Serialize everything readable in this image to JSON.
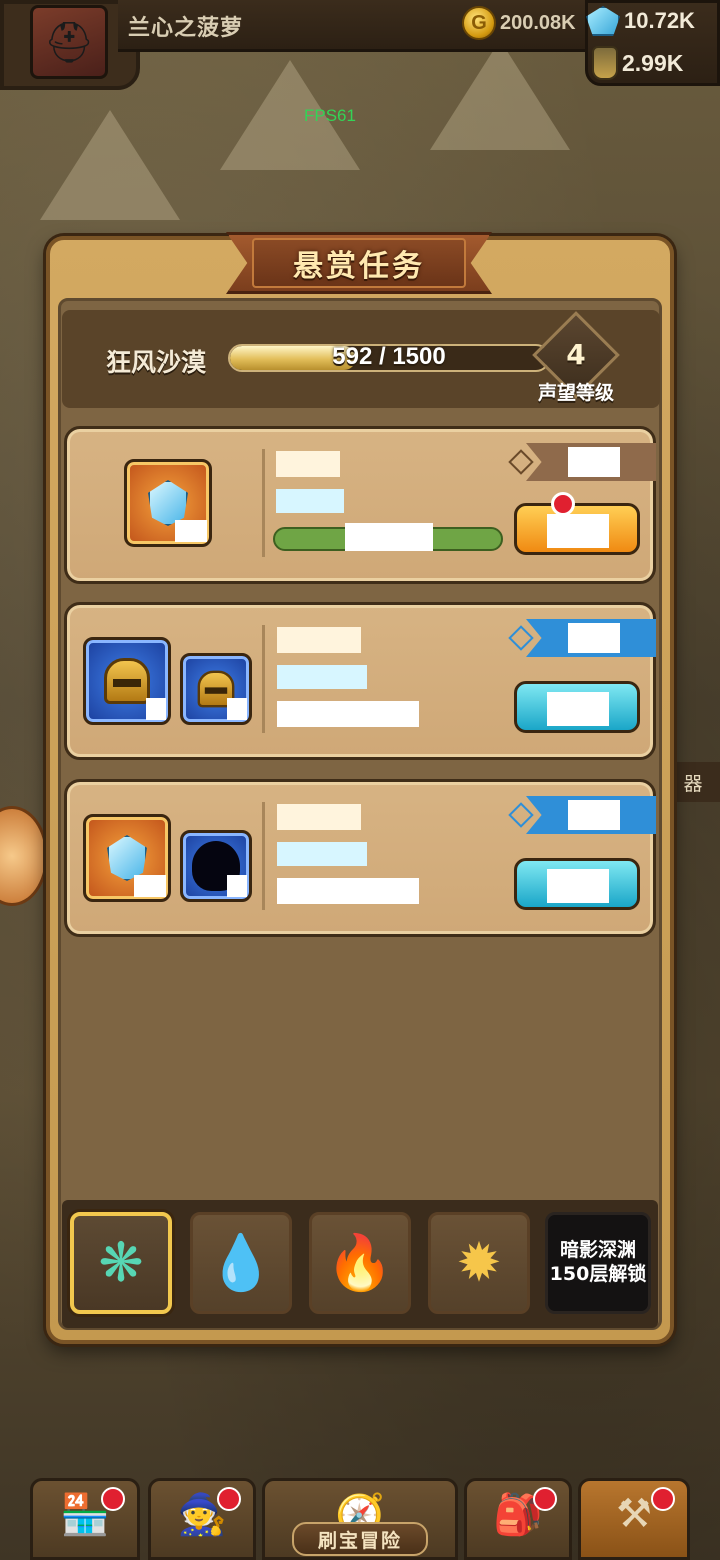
{
  "player": {
    "name": "兰心之菠萝"
  },
  "resources": {
    "gold": "200.08K",
    "gems": "10.72K",
    "potion": "2.99K"
  },
  "debug": {
    "fps": "FPS61"
  },
  "side": {
    "right_label": "器"
  },
  "panel": {
    "title": "悬赏任务"
  },
  "region": {
    "name": "狂风沙漠",
    "progress_text": "592 / 1500",
    "progress_fraction": 0.395,
    "reputation_level": "4",
    "reputation_label": "声望等级"
  },
  "tasks": [
    {
      "reward_icons": [
        "crystal-icon"
      ],
      "tag_color": "brown",
      "button_color": "orange",
      "has_badge": true,
      "progress_fraction": 1.0
    },
    {
      "reward_icons": [
        "helmet-icon",
        "helmet-icon"
      ],
      "tag_color": "blue",
      "button_color": "teal",
      "has_badge": false
    },
    {
      "reward_icons": [
        "crystal-icon",
        "silhouette-icon"
      ],
      "tag_color": "blue",
      "button_color": "teal",
      "has_badge": false
    }
  ],
  "element_tabs": [
    {
      "name": "wind",
      "symbol": "❋",
      "color": "#57d6b4",
      "active": true
    },
    {
      "name": "water",
      "symbol": "💧",
      "color": "#4a7ff0",
      "active": false
    },
    {
      "name": "fire",
      "symbol": "🔥",
      "color": "#e23b2b",
      "active": false
    },
    {
      "name": "light",
      "symbol": "✹",
      "color": "#f6c64a",
      "active": false
    }
  ],
  "abyss": {
    "line1": "暗影深渊",
    "line2": "150层解锁"
  },
  "bottom_nav": {
    "active_label": "刷宝冒险"
  },
  "colors": {
    "accent_gold": "#f2c84e",
    "badge_red": "#e02030",
    "panel_tan": "#d3a961"
  }
}
